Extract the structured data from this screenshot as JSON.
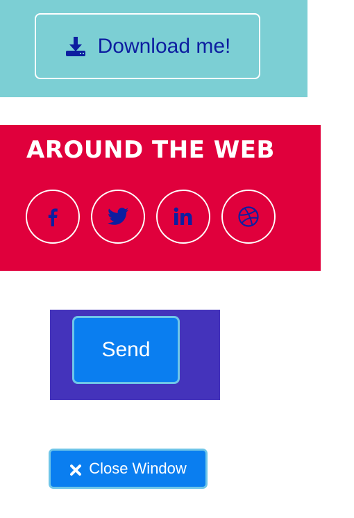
{
  "download": {
    "label": "Download me!",
    "icon": "download-icon",
    "background": "#7ccfd4",
    "text_color": "#0d1ea0"
  },
  "around_the_web": {
    "heading": "AROUND THE WEB",
    "background": "#e0003c",
    "icon_color": "#0d1ea0",
    "links": [
      {
        "icon": "facebook-icon"
      },
      {
        "icon": "twitter-icon"
      },
      {
        "icon": "linkedin-icon"
      },
      {
        "icon": "dribbble-icon"
      }
    ]
  },
  "send": {
    "label": "Send",
    "background": "#4433bb",
    "button_color": "#0a7ef0"
  },
  "close_window": {
    "label": "Close Window",
    "icon": "close-icon",
    "button_color": "#0a7ef0"
  }
}
